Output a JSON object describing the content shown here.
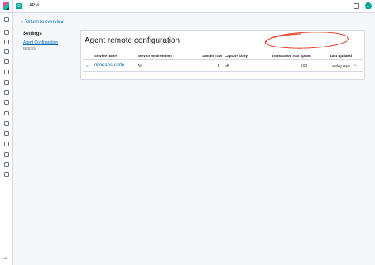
{
  "app": {
    "title": "APM",
    "badge": "D",
    "user_initials": "el"
  },
  "nav": {
    "back_link": "Return to overview"
  },
  "settings": {
    "heading": "Settings",
    "links": [
      "Agent Configuration",
      "Indices"
    ]
  },
  "panel": {
    "title": "Agent remote configuration",
    "columns": [
      "Service name",
      "Service environment",
      "Sample rate",
      "Capture body",
      "Transaction max spans",
      "Last updated"
    ],
    "sort_indicator": "↑",
    "rows": [
      {
        "service_name": "opbeans-node",
        "environment": "All",
        "sample_rate": "1",
        "capture_body": "off",
        "max_spans": "500",
        "last_updated": "a day ago"
      }
    ]
  },
  "annotation": {
    "color": "#e8452c"
  },
  "icons": {
    "edit": "pencil-icon",
    "back": "chevron-left-icon",
    "collapse": "collapse-icon"
  }
}
